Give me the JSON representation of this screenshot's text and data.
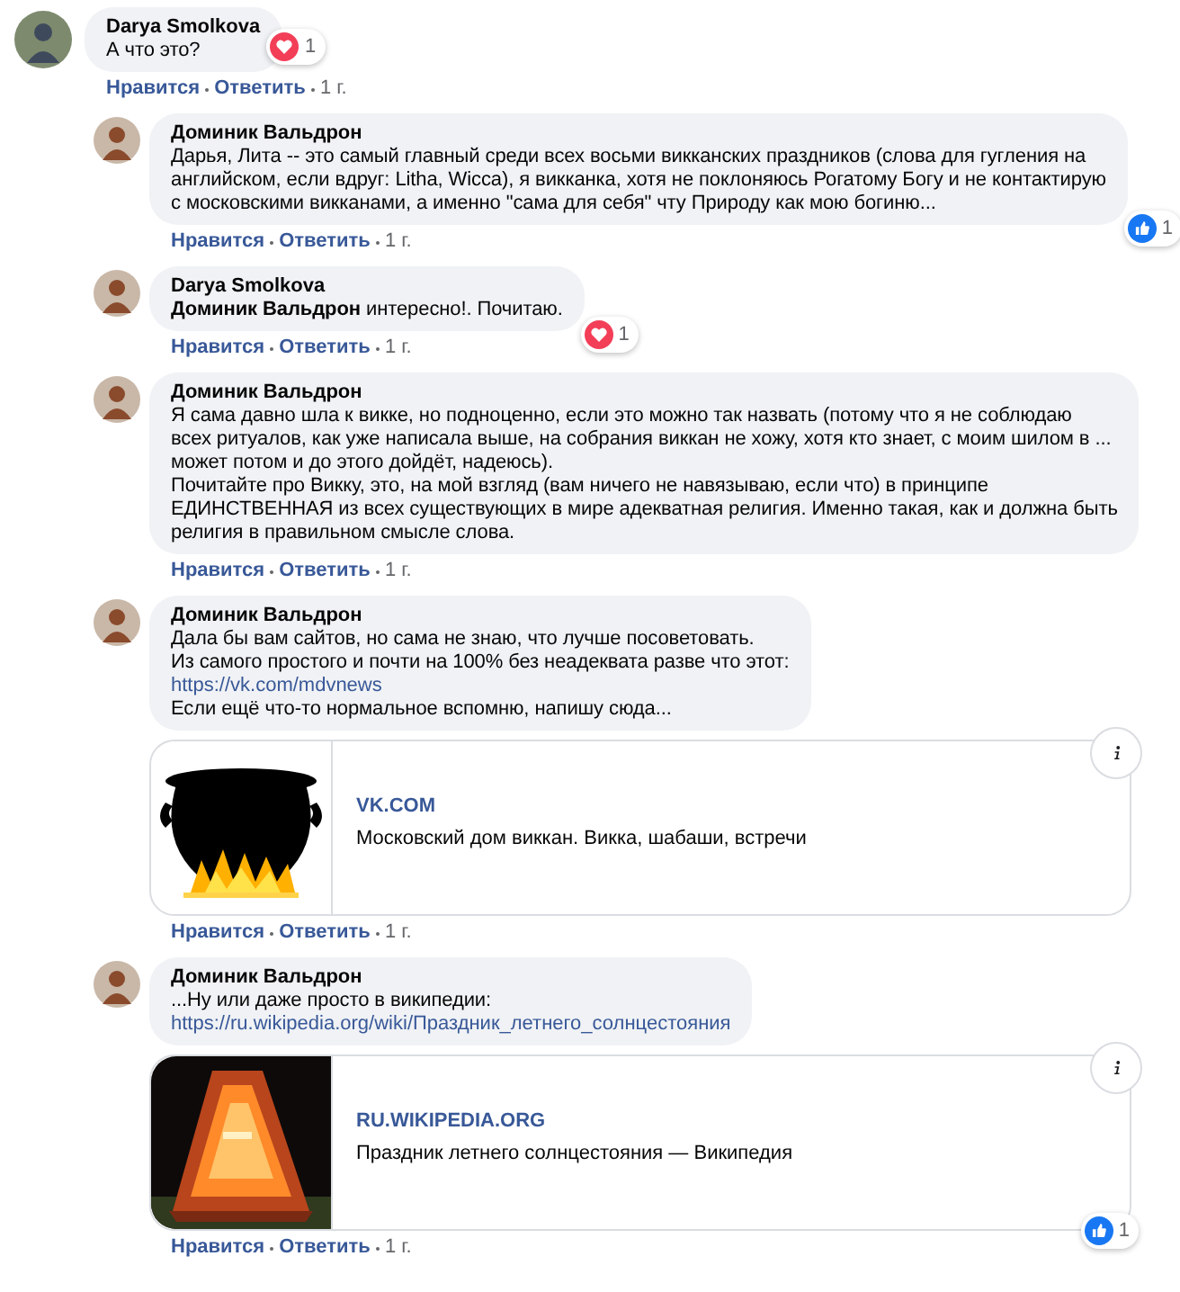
{
  "comments": [
    {
      "author": "Darya Smolkova",
      "parts": [
        {
          "kind": "text",
          "text": "А что это?"
        }
      ],
      "reaction": {
        "kind": "love",
        "count": "1"
      },
      "actions": {
        "like": "Нравится",
        "reply": "Ответить",
        "time": "1 г."
      },
      "replies": [
        {
          "author": "Доминик Вальдрон",
          "parts": [
            {
              "kind": "text",
              "text": "Дарья, Лита -- это самый главный среди всех восьми викканских праздников (слова для гугления на\nанглийском, если вдруг: Litha, Wicca), я викканка, хотя не поклоняюсь Рогатому Богу и не контактирую\nс московскими викканами, а именно \"сама для себя\" чту Природу как мою богиню..."
            }
          ],
          "reaction": {
            "kind": "like",
            "count": "1"
          },
          "actions": {
            "like": "Нравится",
            "reply": "Ответить",
            "time": "1 г."
          }
        },
        {
          "author": "Darya Smolkova",
          "parts": [
            {
              "kind": "text",
              "text": "**Доминик Вальдрон** интересно!. Почитаю."
            }
          ],
          "reaction": {
            "kind": "love",
            "count": "1"
          },
          "actions": {
            "like": "Нравится",
            "reply": "Ответить",
            "time": "1 г."
          }
        },
        {
          "author": "Доминик Вальдрон",
          "parts": [
            {
              "kind": "text",
              "text": "Я сама давно шла к викке, но подноценно, если это можно так назвать (потому что я не соблюдаю\nвсех ритуалов, как уже написала выше, на собрания виккан не хожу, хотя кто знает, с моим шилом в ...\nможет потом и до этого дойдёт, надеюсь).\nПочитайте про Викку, это, на мой взгляд (вам ничего не навязываю, если что) в принципе\nЕДИНСТВЕННАЯ из всех существующих в мире адекватная религия. Именно такая, как и должна быть\nрелигия в правильном смысле слова."
            }
          ],
          "actions": {
            "like": "Нравится",
            "reply": "Ответить",
            "time": "1 г."
          }
        },
        {
          "author": "Доминик Вальдрон",
          "parts": [
            {
              "kind": "text",
              "text": "Дала бы вам сайтов, но сама не знаю, что лучше посоветовать.\nИз самого простого и почти на 100% без неадеквата разве что этот:"
            },
            {
              "kind": "link",
              "text": "https://vk.com/mdvnews"
            },
            {
              "kind": "text",
              "text": "Если ещё что-то нормальное вспомню, напишу сюда..."
            }
          ],
          "preview": {
            "domain": "VK.COM",
            "title": "Московский дом виккан. Викка, шабаши, встречи"
          },
          "actions": {
            "like": "Нравится",
            "reply": "Ответить",
            "time": "1 г."
          }
        },
        {
          "author": "Доминик Вальдрон",
          "parts": [
            {
              "kind": "text",
              "text": "...Ну или даже просто в википедии:"
            },
            {
              "kind": "link",
              "text": "https://ru.wikipedia.org/wiki/Праздник_летнего_солнцестояния"
            }
          ],
          "preview": {
            "domain": "RU.WIKIPEDIA.ORG",
            "title": "Праздник летнего солнцестояния — Википедия"
          },
          "reaction": {
            "kind": "like",
            "count": "1"
          },
          "actions": {
            "like": "Нравится",
            "reply": "Ответить",
            "time": "1 г."
          }
        }
      ]
    }
  ]
}
